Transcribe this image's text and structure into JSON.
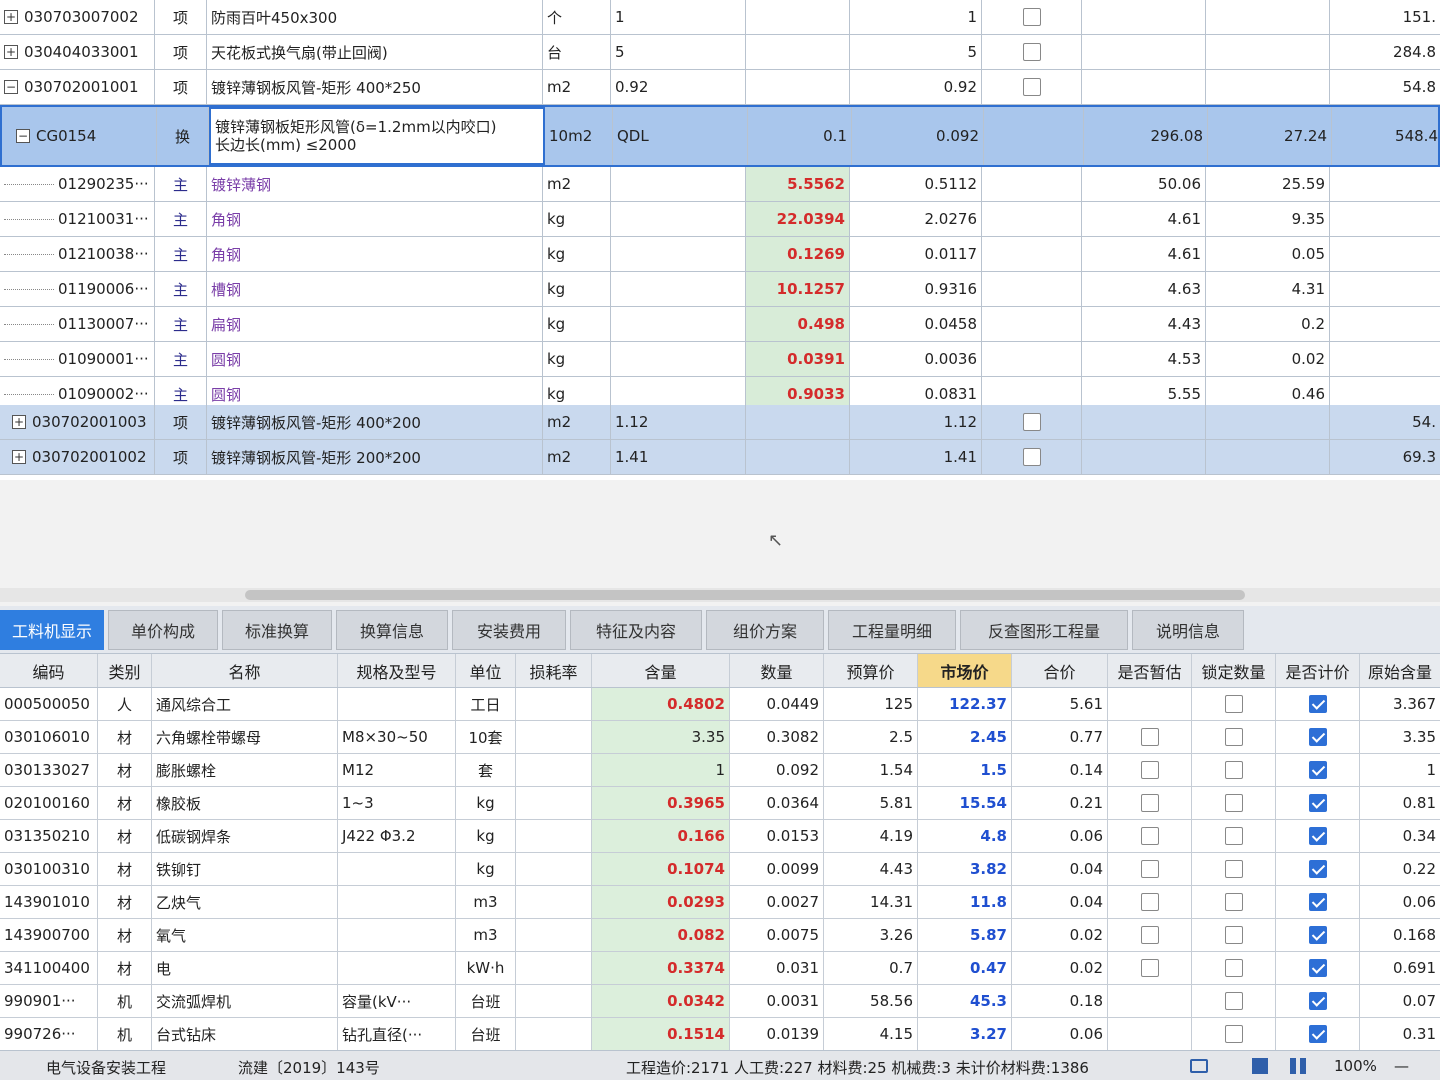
{
  "top_rows": [
    {
      "code": "030703007002",
      "type": "项",
      "name": "防雨百叶450x300",
      "unit": "个",
      "qty_expr": "1",
      "qty": "1",
      "total": "151."
    },
    {
      "code": "030404033001",
      "type": "项",
      "name": "天花板式换气扇(带止回阀)",
      "unit": "台",
      "qty_expr": "5",
      "qty": "5",
      "total": "284.8"
    },
    {
      "code": "030702001001",
      "type": "项",
      "name": "镀锌薄钢板风管-矩形 400*250",
      "unit": "m2",
      "qty_expr": "0.92",
      "qty": "0.92",
      "total": "54.8"
    }
  ],
  "selected_row": {
    "code": "CG0154",
    "type": "换",
    "name_line1": "镀锌薄钢板矩形风管(δ=1.2mm以内咬口)",
    "name_line2": "长边长(mm) ≤2000",
    "unit": "10m2",
    "qty_expr": "QDL",
    "content": "0.1",
    "qty": "0.092",
    "unit_price": "296.08",
    "composite": "27.24",
    "total": "548.4"
  },
  "sub_rows": [
    {
      "code": "01290235···",
      "type": "主",
      "name": "镀锌薄钢",
      "unit": "m2",
      "content": "5.5562",
      "qty": "0.5112",
      "unit_price": "50.06",
      "composite": "25.59"
    },
    {
      "code": "01210031···",
      "type": "主",
      "name": "角钢",
      "unit": "kg",
      "content": "22.0394",
      "qty": "2.0276",
      "unit_price": "4.61",
      "composite": "9.35"
    },
    {
      "code": "01210038···",
      "type": "主",
      "name": "角钢",
      "unit": "kg",
      "content": "0.1269",
      "qty": "0.0117",
      "unit_price": "4.61",
      "composite": "0.05"
    },
    {
      "code": "01190006···",
      "type": "主",
      "name": "槽钢",
      "unit": "kg",
      "content": "10.1257",
      "qty": "0.9316",
      "unit_price": "4.63",
      "composite": "4.31"
    },
    {
      "code": "01130007···",
      "type": "主",
      "name": "扁钢",
      "unit": "kg",
      "content": "0.498",
      "qty": "0.0458",
      "unit_price": "4.43",
      "composite": "0.2"
    },
    {
      "code": "01090001···",
      "type": "主",
      "name": "圆钢",
      "unit": "kg",
      "content": "0.0391",
      "qty": "0.0036",
      "unit_price": "4.53",
      "composite": "0.02"
    },
    {
      "code": "01090002···",
      "type": "主",
      "name": "圆钢",
      "unit": "kg",
      "content": "0.9033",
      "qty": "0.0831",
      "unit_price": "5.55",
      "composite": "0.46"
    }
  ],
  "bottom_top_rows": [
    {
      "code": "030702001003",
      "type": "项",
      "name": "镀锌薄钢板风管-矩形 400*200",
      "unit": "m2",
      "qty_expr": "1.12",
      "qty": "1.12",
      "total": "54."
    },
    {
      "code": "030702001002",
      "type": "项",
      "name": "镀锌薄钢板风管-矩形 200*200",
      "unit": "m2",
      "qty_expr": "1.41",
      "qty": "1.41",
      "total": "69.3"
    }
  ],
  "tabs": [
    "工料机显示",
    "单价构成",
    "标准换算",
    "换算信息",
    "安装费用",
    "特征及内容",
    "组价方案",
    "工程量明细",
    "反查图形工程量",
    "说明信息"
  ],
  "bottom_headers": {
    "code": "编码",
    "type": "类别",
    "name": "名称",
    "spec": "规格及型号",
    "unit": "单位",
    "loss": "损耗率",
    "content": "含量",
    "qty": "数量",
    "budget": "预算价",
    "market": "市场价",
    "sum": "合价",
    "temp": "是否暂估",
    "lock": "锁定数量",
    "calc": "是否计价",
    "orig": "原始含量"
  },
  "bottom_rows": [
    {
      "code": "000500050",
      "type": "人",
      "name": "通风综合工",
      "spec": "",
      "unit": "工日",
      "content": "0.4802",
      "content_red": true,
      "qty": "0.0449",
      "budget": "125",
      "market": "122.37",
      "sum": "5.61",
      "temp_box": false,
      "lock_checked": false,
      "calc_checked": true,
      "orig": "3.367"
    },
    {
      "code": "030106010",
      "type": "材",
      "name": "六角螺栓带螺母",
      "spec": "M8×30~50",
      "unit": "10套",
      "content": "3.35",
      "content_red": false,
      "qty": "0.3082",
      "budget": "2.5",
      "market": "2.45",
      "sum": "0.77",
      "temp_box": true,
      "lock_checked": false,
      "calc_checked": true,
      "orig": "3.35"
    },
    {
      "code": "030133027",
      "type": "材",
      "name": "膨胀螺栓",
      "spec": "M12",
      "unit": "套",
      "content": "1",
      "content_red": false,
      "qty": "0.092",
      "budget": "1.54",
      "market": "1.5",
      "sum": "0.14",
      "temp_box": true,
      "lock_checked": false,
      "calc_checked": true,
      "orig": "1"
    },
    {
      "code": "020100160",
      "type": "材",
      "name": "橡胶板",
      "spec": "1~3",
      "unit": "kg",
      "content": "0.3965",
      "content_red": true,
      "qty": "0.0364",
      "budget": "5.81",
      "market": "15.54",
      "sum": "0.21",
      "temp_box": true,
      "lock_checked": false,
      "calc_checked": true,
      "orig": "0.81"
    },
    {
      "code": "031350210",
      "type": "材",
      "name": "低碳钢焊条",
      "spec": "J422 Φ3.2",
      "unit": "kg",
      "content": "0.166",
      "content_red": true,
      "qty": "0.0153",
      "budget": "4.19",
      "market": "4.8",
      "sum": "0.06",
      "temp_box": true,
      "lock_checked": false,
      "calc_checked": true,
      "orig": "0.34"
    },
    {
      "code": "030100310",
      "type": "材",
      "name": "铁铆钉",
      "spec": "",
      "unit": "kg",
      "content": "0.1074",
      "content_red": true,
      "qty": "0.0099",
      "budget": "4.43",
      "market": "3.82",
      "sum": "0.04",
      "temp_box": true,
      "lock_checked": false,
      "calc_checked": true,
      "orig": "0.22"
    },
    {
      "code": "143901010",
      "type": "材",
      "name": "乙炔气",
      "spec": "",
      "unit": "m3",
      "content": "0.0293",
      "content_red": true,
      "qty": "0.0027",
      "budget": "14.31",
      "market": "11.8",
      "sum": "0.04",
      "temp_box": true,
      "lock_checked": false,
      "calc_checked": true,
      "orig": "0.06"
    },
    {
      "code": "143900700",
      "type": "材",
      "name": "氧气",
      "spec": "",
      "unit": "m3",
      "content": "0.082",
      "content_red": true,
      "qty": "0.0075",
      "budget": "3.26",
      "market": "5.87",
      "sum": "0.02",
      "temp_box": true,
      "lock_checked": false,
      "calc_checked": true,
      "orig": "0.168"
    },
    {
      "code": "341100400",
      "type": "材",
      "name": "电",
      "spec": "",
      "unit": "kW·h",
      "content": "0.3374",
      "content_red": true,
      "qty": "0.031",
      "budget": "0.7",
      "market": "0.47",
      "sum": "0.02",
      "temp_box": true,
      "lock_checked": false,
      "calc_checked": true,
      "orig": "0.691"
    },
    {
      "code": "990901···",
      "type": "机",
      "name": "交流弧焊机",
      "spec": "容量(kV···",
      "unit": "台班",
      "content": "0.0342",
      "content_red": true,
      "qty": "0.0031",
      "budget": "58.56",
      "market": "45.3",
      "sum": "0.18",
      "temp_box": false,
      "lock_checked": false,
      "calc_checked": true,
      "orig": "0.07"
    },
    {
      "code": "990726···",
      "type": "机",
      "name": "台式钻床",
      "spec": "钻孔直径(···",
      "unit": "台班",
      "content": "0.1514",
      "content_red": true,
      "qty": "0.0139",
      "budget": "4.15",
      "market": "3.27",
      "sum": "0.06",
      "temp_box": false,
      "lock_checked": false,
      "calc_checked": true,
      "orig": "0.31"
    }
  ],
  "statusbar": {
    "profession": "电气设备安装工程",
    "standard": "流建〔2019〕143号",
    "summary": "工程造价:2171  人工费:227  材料费:25  机械费:3  未计价材料费:1386",
    "zoom": "100%"
  },
  "colors": {
    "selection": "#a9c6ec",
    "tab_active": "#2f7ee0",
    "red_value": "#d42b2b",
    "blue_value": "#1f4fd0"
  }
}
